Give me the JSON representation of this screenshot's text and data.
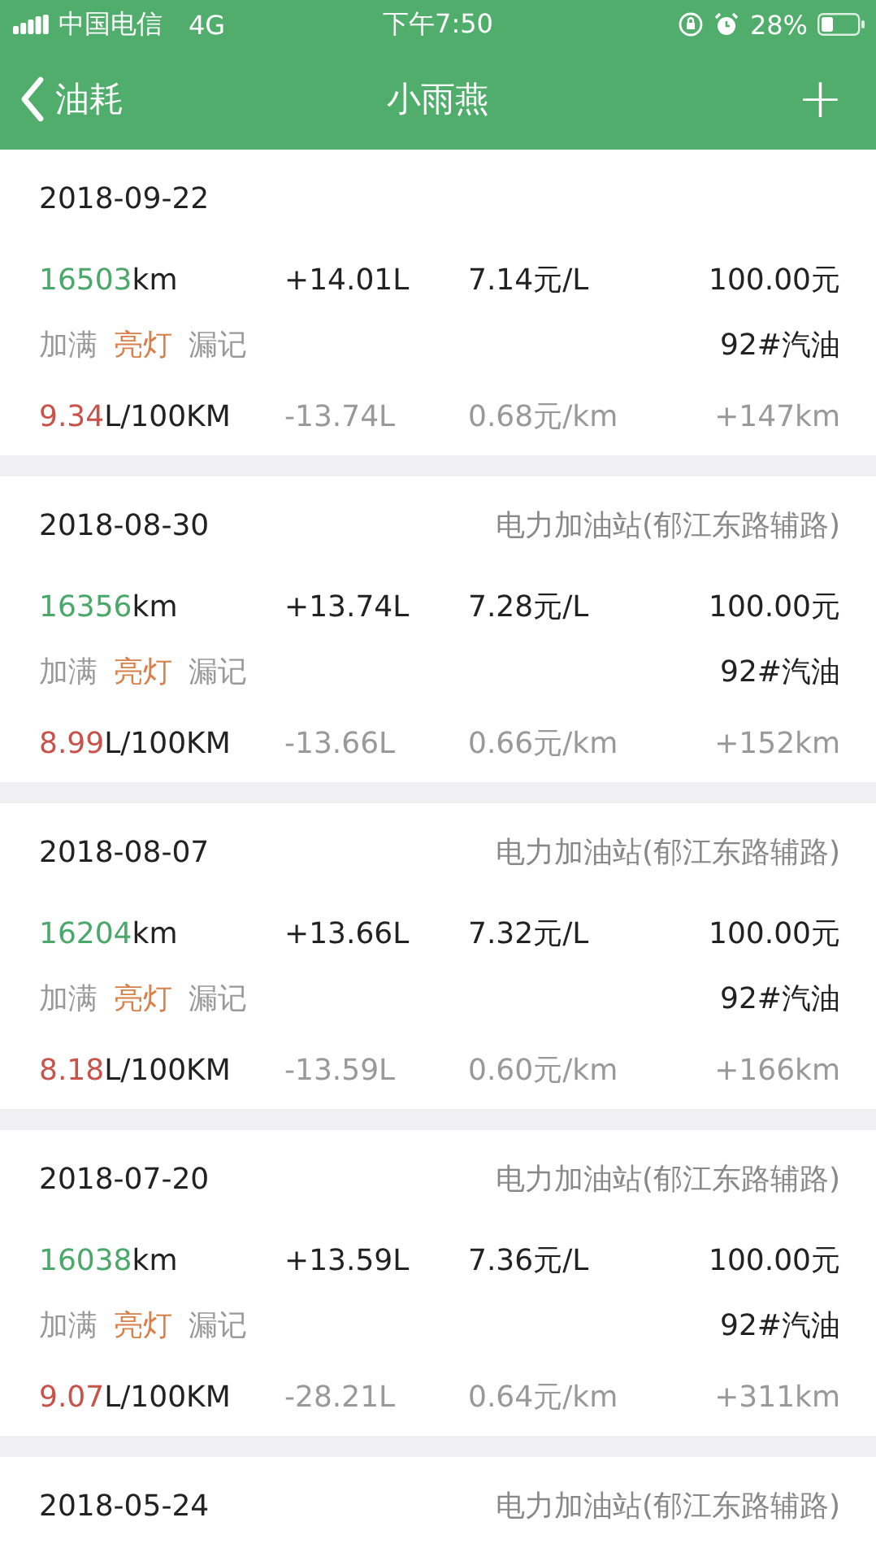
{
  "status_bar": {
    "carrier": "中国电信",
    "network": "4G",
    "time": "下午7:50",
    "battery": "28%"
  },
  "nav": {
    "back": "油耗",
    "title": "小雨燕",
    "add": "+"
  },
  "records": [
    {
      "date": "2018-09-22",
      "odometer": "16503",
      "odometer_unit": "km",
      "liters": "+14.01L",
      "price": "7.14元/L",
      "amount": "100.00元",
      "tags": [
        {
          "label": "加满",
          "on": false
        },
        {
          "label": "亮灯",
          "on": true
        },
        {
          "label": "漏记",
          "on": false
        }
      ],
      "fuel": "92#汽油",
      "consumption": "9.34",
      "consumption_unit": "L/100KM",
      "liters_diff": "-13.74L",
      "cost_per_km": "0.68元/km",
      "distance": "+147km"
    },
    {
      "date": "2018-08-30",
      "station": "电力加油站(郁江东路辅路)",
      "odometer": "16356",
      "odometer_unit": "km",
      "liters": "+13.74L",
      "price": "7.28元/L",
      "amount": "100.00元",
      "tags": [
        {
          "label": "加满",
          "on": false
        },
        {
          "label": "亮灯",
          "on": true
        },
        {
          "label": "漏记",
          "on": false
        }
      ],
      "fuel": "92#汽油",
      "consumption": "8.99",
      "consumption_unit": "L/100KM",
      "liters_diff": "-13.66L",
      "cost_per_km": "0.66元/km",
      "distance": "+152km"
    },
    {
      "date": "2018-08-07",
      "station": "电力加油站(郁江东路辅路)",
      "odometer": "16204",
      "odometer_unit": "km",
      "liters": "+13.66L",
      "price": "7.32元/L",
      "amount": "100.00元",
      "tags": [
        {
          "label": "加满",
          "on": false
        },
        {
          "label": "亮灯",
          "on": true
        },
        {
          "label": "漏记",
          "on": false
        }
      ],
      "fuel": "92#汽油",
      "consumption": "8.18",
      "consumption_unit": "L/100KM",
      "liters_diff": "-13.59L",
      "cost_per_km": "0.60元/km",
      "distance": "+166km"
    },
    {
      "date": "2018-07-20",
      "station": "电力加油站(郁江东路辅路)",
      "odometer": "16038",
      "odometer_unit": "km",
      "liters": "+13.59L",
      "price": "7.36元/L",
      "amount": "100.00元",
      "tags": [
        {
          "label": "加满",
          "on": false
        },
        {
          "label": "亮灯",
          "on": true
        },
        {
          "label": "漏记",
          "on": false
        }
      ],
      "fuel": "92#汽油",
      "consumption": "9.07",
      "consumption_unit": "L/100KM",
      "liters_diff": "-28.21L",
      "cost_per_km": "0.64元/km",
      "distance": "+311km"
    },
    {
      "date": "2018-05-24",
      "station": "电力加油站(郁江东路辅路)"
    }
  ]
}
